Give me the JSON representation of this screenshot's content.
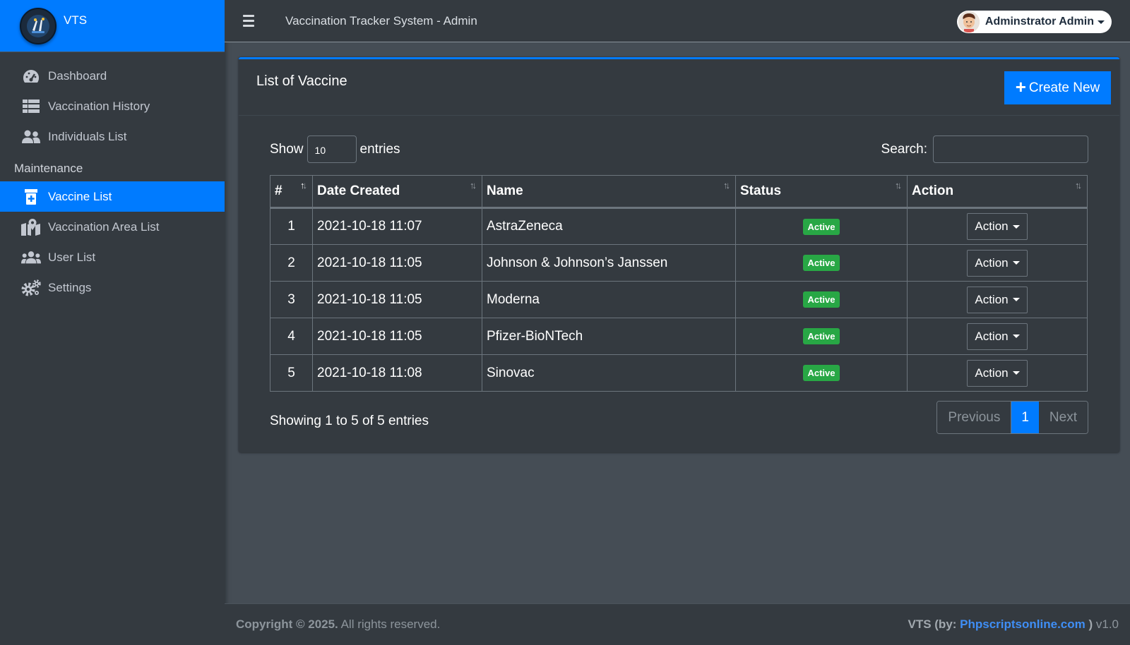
{
  "brand": {
    "name": "VTS"
  },
  "header": {
    "title": "Vaccination Tracker System - Admin",
    "user_name": "Adminstrator Admin"
  },
  "sidebar": {
    "items": [
      {
        "label": "Dashboard",
        "icon": "tachometer-icon"
      },
      {
        "label": "Vaccination History",
        "icon": "table-icon"
      },
      {
        "label": "Individuals List",
        "icon": "users-icon"
      }
    ],
    "section_header": "Maintenance",
    "maintenance_items": [
      {
        "label": "Vaccine List",
        "icon": "prescription-bottle-icon",
        "active": true
      },
      {
        "label": "Vaccination Area List",
        "icon": "map-marked-icon"
      },
      {
        "label": "User List",
        "icon": "users-cog-icon"
      },
      {
        "label": "Settings",
        "icon": "cogs-icon"
      }
    ]
  },
  "card": {
    "title": "List of Vaccine",
    "create_label": "Create New",
    "show_label": "Show",
    "entries_label": "entries",
    "page_length": "10",
    "search_label": "Search:",
    "search_value": ""
  },
  "table": {
    "columns": [
      "#",
      "Date Created",
      "Name",
      "Status",
      "Action"
    ],
    "rows": [
      {
        "num": "1",
        "date": "2021-10-18 11:07",
        "name": "AstraZeneca",
        "status": "Active",
        "action": "Action"
      },
      {
        "num": "2",
        "date": "2021-10-18 11:05",
        "name": "Johnson & Johnson’s Janssen",
        "status": "Active",
        "action": "Action"
      },
      {
        "num": "3",
        "date": "2021-10-18 11:05",
        "name": "Moderna",
        "status": "Active",
        "action": "Action"
      },
      {
        "num": "4",
        "date": "2021-10-18 11:05",
        "name": "Pfizer-BioNTech",
        "status": "Active",
        "action": "Action"
      },
      {
        "num": "5",
        "date": "2021-10-18 11:08",
        "name": "Sinovac",
        "status": "Active",
        "action": "Action"
      }
    ]
  },
  "pagination": {
    "info": "Showing 1 to 5 of 5 entries",
    "previous": "Previous",
    "page": "1",
    "next": "Next"
  },
  "footer": {
    "copyright_bold": "Copyright © 2025.",
    "copyright_rest": " All rights reserved.",
    "credit_prefix": "VTS (by: ",
    "credit_link": "Phpscriptsonline.com",
    "credit_suffix": " )",
    "version": " v1.0"
  },
  "colors": {
    "primary": "#007bff",
    "success": "#28a745",
    "sidebar_bg": "#343a40",
    "content_bg": "#454d55"
  }
}
